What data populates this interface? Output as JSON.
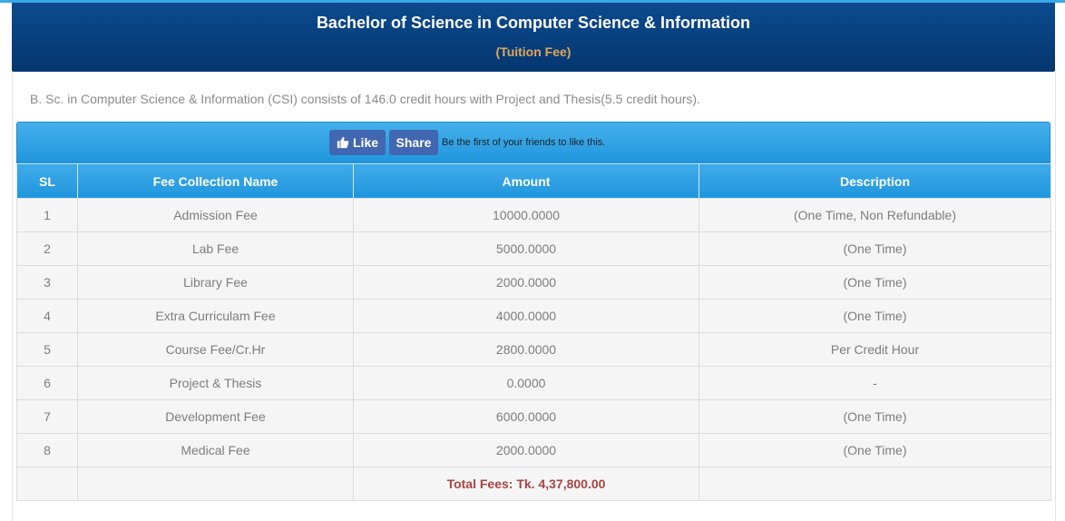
{
  "header": {
    "title": "Bachelor of Science in Computer Science & Information",
    "subtitle": "(Tuition Fee)"
  },
  "description": "B. Sc. in Computer Science & Information (CSI) consists of 146.0 credit hours with Project and Thesis(5.5 credit hours).",
  "facebook": {
    "like_label": "Like",
    "share_label": "Share",
    "social_text": "Be the first of your friends to like this."
  },
  "table": {
    "columns": [
      "SL",
      "Fee Collection Name",
      "Amount",
      "Description"
    ],
    "rows": [
      {
        "sl": "1",
        "name": "Admission Fee",
        "amount": "10000.0000",
        "description": "(One Time, Non Refundable)"
      },
      {
        "sl": "2",
        "name": "Lab Fee",
        "amount": "5000.0000",
        "description": "(One Time)"
      },
      {
        "sl": "3",
        "name": "Library Fee",
        "amount": "2000.0000",
        "description": "(One Time)"
      },
      {
        "sl": "4",
        "name": "Extra Curriculam Fee",
        "amount": "4000.0000",
        "description": "(One Time)"
      },
      {
        "sl": "5",
        "name": "Course Fee/Cr.Hr",
        "amount": "2800.0000",
        "description": "Per Credit Hour"
      },
      {
        "sl": "6",
        "name": "Project & Thesis",
        "amount": "0.0000",
        "description": "-"
      },
      {
        "sl": "7",
        "name": "Development Fee",
        "amount": "6000.0000",
        "description": "(One Time)"
      },
      {
        "sl": "8",
        "name": "Medical Fee",
        "amount": "2000.0000",
        "description": "(One Time)"
      }
    ],
    "total": "Total Fees: Tk. 4,37,800.00"
  },
  "colors": {
    "header_bg": "#06407c",
    "subtitle": "#e0a75a",
    "table_header": "#2a9ce2",
    "facebook_button": "#4267b2",
    "total_text": "#a94442"
  },
  "icons": {
    "like": "thumbs-up-icon"
  }
}
